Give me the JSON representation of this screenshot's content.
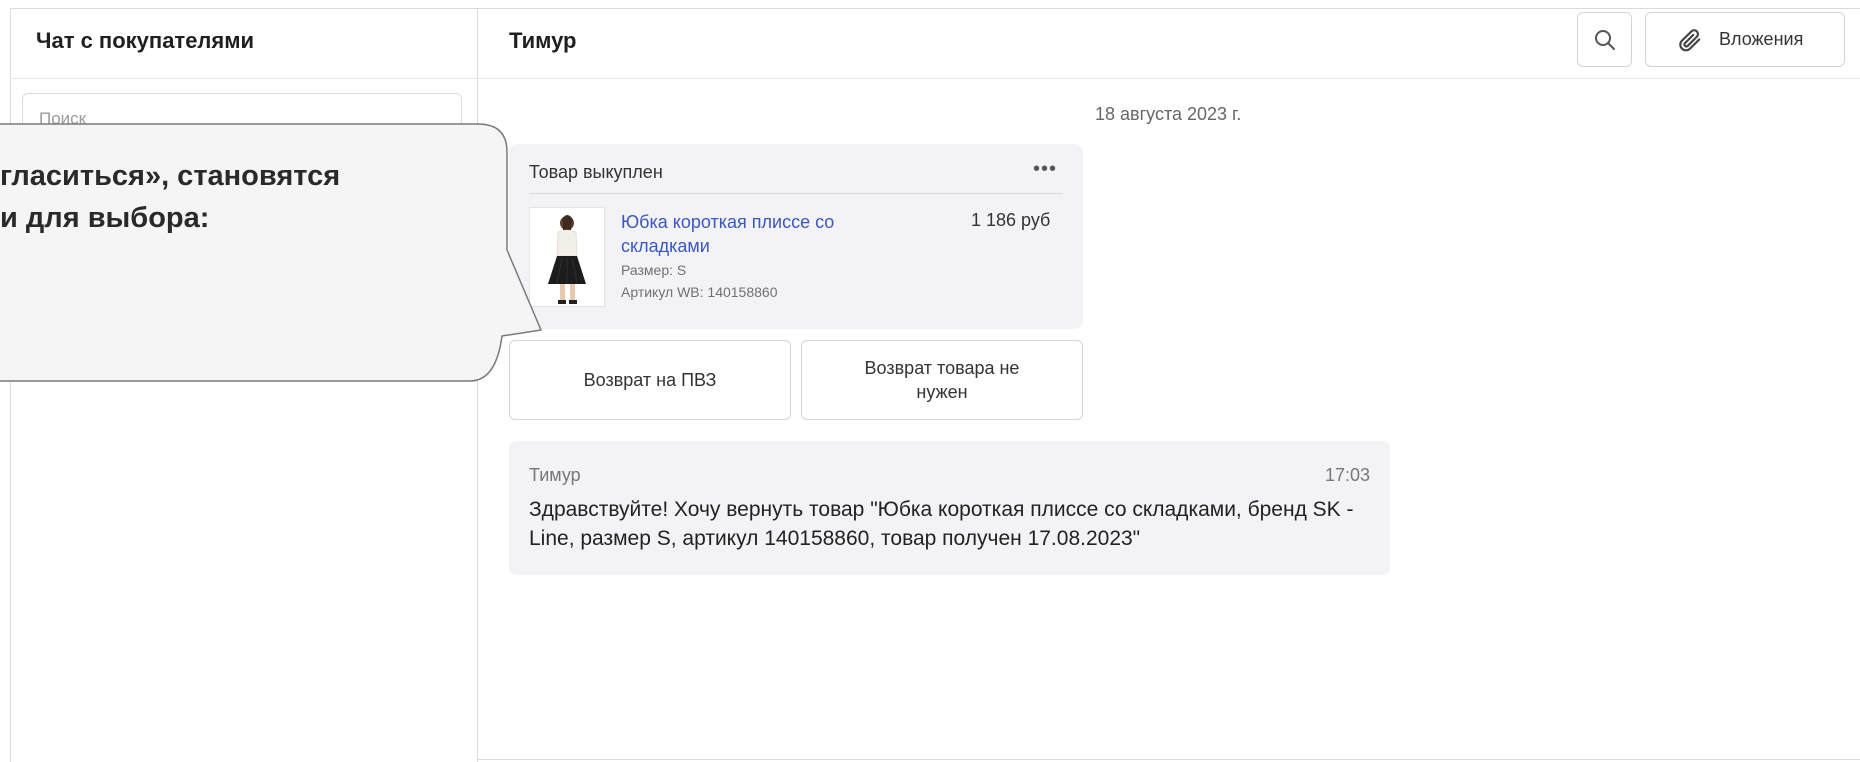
{
  "sidebar": {
    "title": "Чат с покупателями",
    "search_placeholder": "Поиск"
  },
  "chat": {
    "title": "Тимур",
    "attachments_label": "Вложения",
    "search_icon": "search-icon",
    "attach_icon": "paperclip-icon",
    "date": "18 августа 2023 г."
  },
  "product_card": {
    "status": "Товар выкуплен",
    "more_icon": "•••",
    "name": "Юбка короткая плиссе со складками",
    "price": "1 186 руб",
    "size": "Размер: S",
    "sku": "Артикул WB: 140158860"
  },
  "actions": {
    "return_pvz": "Возврат на ПВЗ",
    "no_return": "Возврат товара не нужен"
  },
  "message": {
    "author": "Тимур",
    "time": "17:03",
    "text": "Здравствуйте! Хочу вернуть товар \"Юбка короткая плиссе со складками, бренд SK - Line, размер S, артикул 140158860, товар получен 17.08.2023\""
  },
  "callout": {
    "line1": "гласиться», становятся",
    "line2": "и для выбора:"
  },
  "colors": {
    "link": "#3a57c4",
    "bubble": "#f3f3f6",
    "border": "#d4d4d8",
    "callout_fill": "#f5f5f5"
  }
}
